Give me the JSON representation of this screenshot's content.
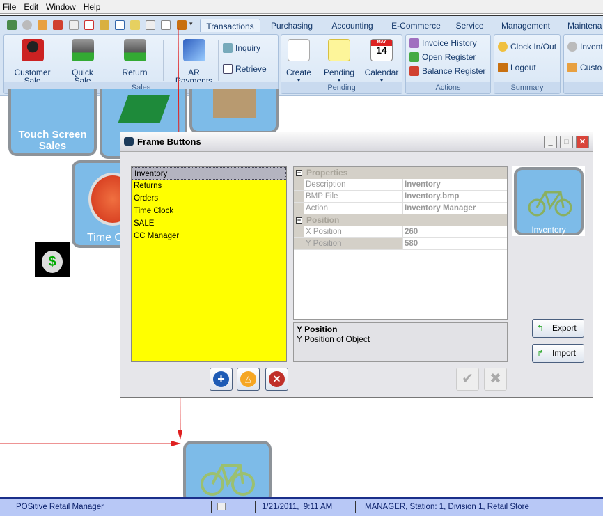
{
  "menu": [
    "File",
    "Edit",
    "Window",
    "Help"
  ],
  "tabs": [
    "Transactions",
    "Purchasing",
    "Accounting",
    "E-Commerce",
    "Service",
    "Management",
    "Maintena"
  ],
  "active_tab": "Transactions",
  "ribbon": {
    "sales": {
      "label": "Sales",
      "buttons": [
        "Customer\nSale",
        "Quick\nSale",
        "Return",
        "AR\nPayments"
      ],
      "small": [
        "Inquiry",
        "Retrieve"
      ]
    },
    "pending": {
      "label": "Pending",
      "buttons": [
        "Create",
        "Pending",
        "Calendar"
      ]
    },
    "actions": {
      "label": "Actions",
      "small": [
        "Invoice History",
        "Open Register",
        "Balance Register"
      ]
    },
    "summary": {
      "label": "Summary",
      "small": [
        "Clock In/Out",
        "Logout"
      ]
    },
    "more": {
      "small": [
        "Invent",
        "Custo"
      ]
    }
  },
  "calendar_icon": {
    "month": "MAY",
    "day": "14"
  },
  "tiles": {
    "touch": "Touch Screen\nSales",
    "time": "Time C",
    "inventory": "Inventory"
  },
  "dialog": {
    "title": "Frame Buttons",
    "list": [
      "Inventory",
      "Returns",
      "Orders",
      "Time Clock",
      "SALE",
      "CC Manager"
    ],
    "selected": "Inventory",
    "properties_header": "Properties",
    "properties": [
      {
        "k": "Description",
        "v": "Inventory"
      },
      {
        "k": "BMP File",
        "v": "Inventory.bmp"
      },
      {
        "k": "Action",
        "v": "Inventory Manager"
      }
    ],
    "position_header": "Position",
    "position": [
      {
        "k": "X Position",
        "v": "260"
      },
      {
        "k": "Y Position",
        "v": "580"
      }
    ],
    "desc_title": "Y Position",
    "desc_text": "Y Position of Object",
    "preview_label": "Inventory",
    "export": "Export",
    "import": "Import"
  },
  "status": {
    "app": "POSitive Retail Manager",
    "datetime": "1/21/2011,  9:11 AM",
    "session": "MANAGER, Station: 1, Division 1, Retail Store"
  },
  "colors": {
    "list_bg": "#ffff00",
    "tile": "#7dbbe8",
    "arrow": "#e02020"
  }
}
